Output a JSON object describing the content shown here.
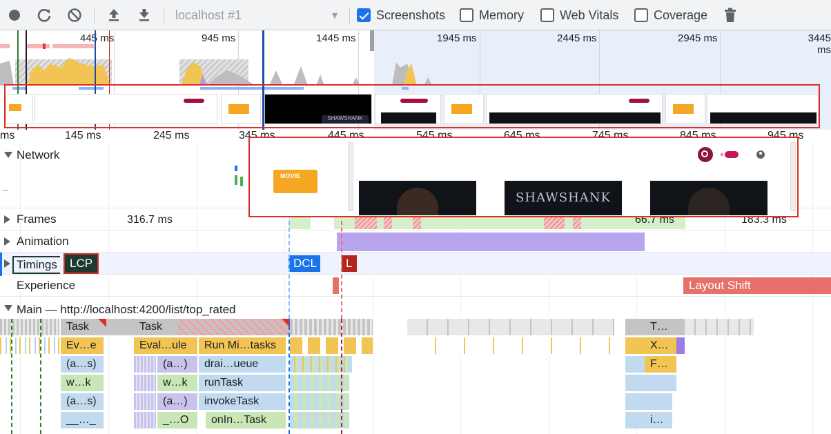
{
  "toolbar": {
    "profile": "localhost #1",
    "checkboxes": [
      {
        "label": "Screenshots",
        "checked": true
      },
      {
        "label": "Memory",
        "checked": false
      },
      {
        "label": "Web Vitals",
        "checked": false
      },
      {
        "label": "Coverage",
        "checked": false
      }
    ],
    "icons": [
      "record-icon",
      "reload-icon",
      "clear-icon",
      "upload-icon",
      "download-icon",
      "trash-icon"
    ]
  },
  "overview": {
    "ticks": [
      "445 ms",
      "945 ms",
      "1445 ms",
      "1945 ms",
      "2445 ms",
      "2945 ms",
      "3445 ms"
    ]
  },
  "ruler": {
    "ticks": [
      "ms",
      "145 ms",
      "245 ms",
      "345 ms",
      "445 ms",
      "545 ms",
      "645 ms",
      "745 ms",
      "845 ms",
      "945 ms"
    ]
  },
  "tracks": {
    "network": "Network",
    "frames": "Frames",
    "frames_values": [
      "316.7 ms",
      "66.7 ms",
      "183.3 ms"
    ],
    "animation": "Animation",
    "timings": "Timings",
    "timing_markers": [
      "LCP",
      "DCL",
      "L"
    ],
    "experience": "Experience",
    "layout_shift": "Layout Shift",
    "main": "Main — http://localhost:4200/list/top_rated"
  },
  "flame": {
    "row1": [
      "Task",
      "Task",
      "T…"
    ],
    "row2": [
      "Ev…e",
      "Eval…ule",
      "Run Mi…tasks",
      "X…"
    ],
    "row3": [
      "(a…s)",
      "(a…)",
      "drai…ueue",
      "F…"
    ],
    "row4": [
      "w…k",
      "w…k",
      "runTask"
    ],
    "row5": [
      "(a…s)",
      "(a…)",
      "invokeTask"
    ],
    "row6": [
      "__…_",
      "_…O",
      "onIn…Task",
      "i…"
    ]
  },
  "popup": {
    "logo_text": "MOVIE",
    "poster_title": "SHAWSHANK"
  },
  "colors": {
    "accent": "#1a73e8",
    "task_gray": "#c4c4c4",
    "scripting_yellow": "#f1c453",
    "blue_call": "#c1daf0",
    "purple_call": "#c8c3ea",
    "green_call": "#c8e6b6",
    "animation": "#b9a5ee",
    "layout_shift": "#e8706a",
    "dcl": "#1a73e8",
    "load": "#b3261e",
    "lcp": "#1e3a2f"
  }
}
